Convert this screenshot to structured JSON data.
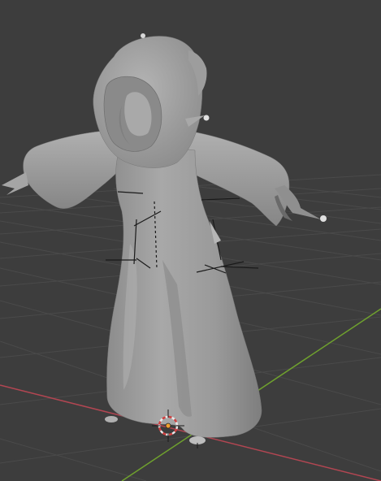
{
  "viewport": {
    "mode": "3d-viewport",
    "shading": "solid",
    "background_color": "#3d3d3d",
    "grid_color": "#4a4a4a",
    "x_axis_color": "#b24652",
    "y_axis_color": "#6fa12e",
    "mesh_color": "#9a9a9a"
  },
  "scene": {
    "object": "hooded-ghost-mesh",
    "armature_visible": true,
    "cursor_3d_visible": true,
    "origin_marker_color": "#f0a030"
  }
}
